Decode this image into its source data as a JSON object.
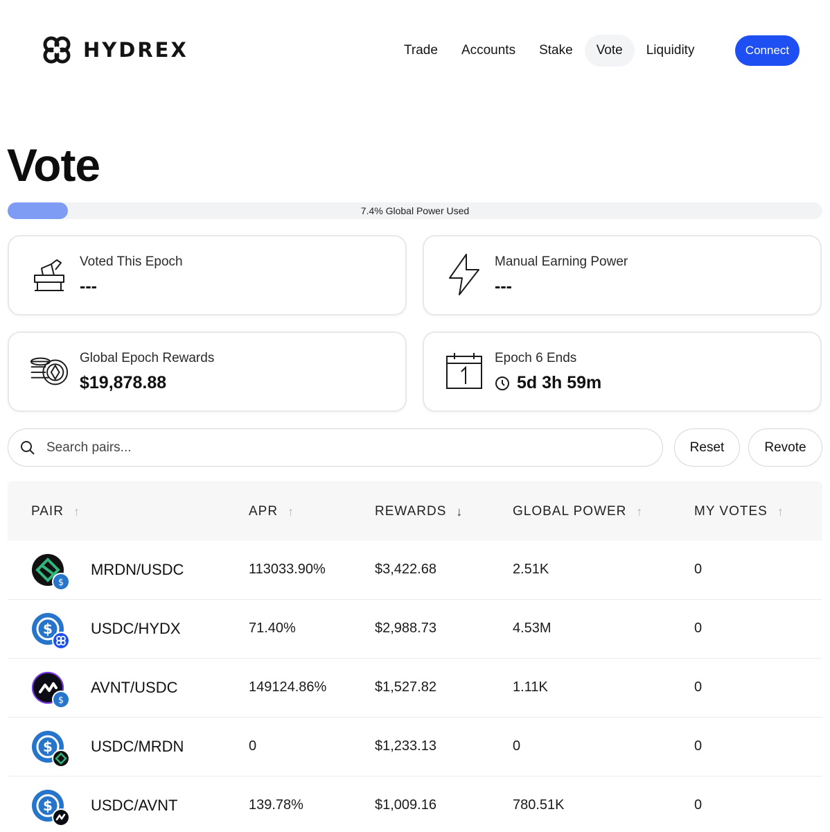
{
  "header": {
    "logo_text": "HYDREX",
    "nav": [
      "Trade",
      "Accounts",
      "Stake",
      "Vote",
      "Liquidity"
    ],
    "active_nav": "Vote",
    "connect_label": "Connect",
    "accent_color": "#1d4ff2"
  },
  "page": {
    "title": "Vote",
    "power_label": "7.4% Global Power Used",
    "power_fraction": 0.074
  },
  "cards": {
    "voted": {
      "label": "Voted This Epoch",
      "value": "---",
      "icon": "ballot-box-icon"
    },
    "earning": {
      "label": "Manual Earning Power",
      "value": "---",
      "icon": "lightning-icon"
    },
    "rewards": {
      "label": "Global Epoch Rewards",
      "value": "$19,878.88",
      "icon": "coins-icon"
    },
    "epoch": {
      "label": "Epoch 6 Ends",
      "value": "5d 3h 59m",
      "icon": "calendar-icon"
    }
  },
  "search": {
    "placeholder": "Search pairs..."
  },
  "actions": {
    "reset": "Reset",
    "revote": "Revote"
  },
  "table": {
    "columns": [
      "PAIR",
      "APR",
      "REWARDS",
      "GLOBAL POWER",
      "MY VOTES"
    ],
    "sort_column": "REWARDS",
    "rows": [
      {
        "pair": "MRDN/USDC",
        "apr": "113033.90%",
        "rewards": "$3,422.68",
        "global_power": "2.51K",
        "my_votes": "0"
      },
      {
        "pair": "USDC/HYDX",
        "apr": "71.40%",
        "rewards": "$2,988.73",
        "global_power": "4.53M",
        "my_votes": "0"
      },
      {
        "pair": "AVNT/USDC",
        "apr": "149124.86%",
        "rewards": "$1,527.82",
        "global_power": "1.11K",
        "my_votes": "0"
      },
      {
        "pair": "USDC/MRDN",
        "apr": "0",
        "rewards": "$1,233.13",
        "global_power": "0",
        "my_votes": "0"
      },
      {
        "pair": "USDC/AVNT",
        "apr": "139.78%",
        "rewards": "$1,009.16",
        "global_power": "780.51K",
        "my_votes": "0"
      }
    ]
  }
}
